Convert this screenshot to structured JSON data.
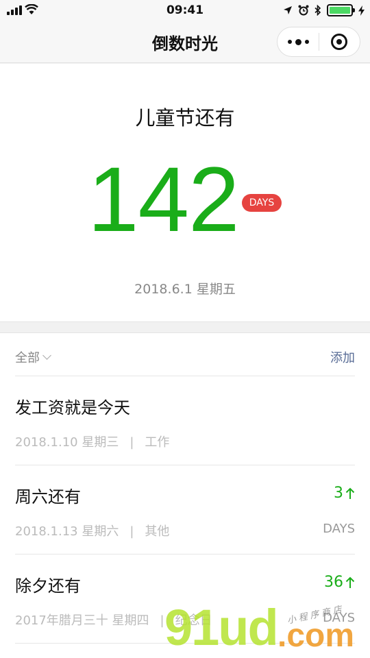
{
  "status_bar": {
    "time": "09:41",
    "icons": [
      "signal-icon",
      "wifi-icon",
      "location-icon",
      "alarm-icon",
      "bluetooth-icon",
      "battery-icon",
      "charging-icon"
    ],
    "battery_level": 1.0
  },
  "nav": {
    "title": "倒数时光",
    "more_icon": "more-dots-icon",
    "close_icon": "target-icon"
  },
  "hero": {
    "title": "儿童节还有",
    "count": "142",
    "unit": "DAYS",
    "date": "2018.6.1 星期五"
  },
  "list": {
    "filter_label": "全部",
    "add_label": "添加",
    "items": [
      {
        "title": "发工资就是今天",
        "date": "2018.1.10 星期三",
        "separator": "|",
        "category": "工作",
        "count": "",
        "unit": ""
      },
      {
        "title": "周六还有",
        "date": "2018.1.13 星期六",
        "separator": "|",
        "category": "其他",
        "count": "3",
        "unit": "DAYS"
      },
      {
        "title": "除夕还有",
        "date": "2017年腊月三十 星期四",
        "separator": "|",
        "category": "纪念日",
        "count": "36",
        "unit": "DAYS"
      }
    ]
  },
  "watermark": {
    "big_text": "91ud",
    "dot_text": ".com",
    "small_text": "小程序商店"
  },
  "colors": {
    "accent_green": "#1aad19",
    "badge_red": "#e64340",
    "link_blue": "#576b95"
  }
}
